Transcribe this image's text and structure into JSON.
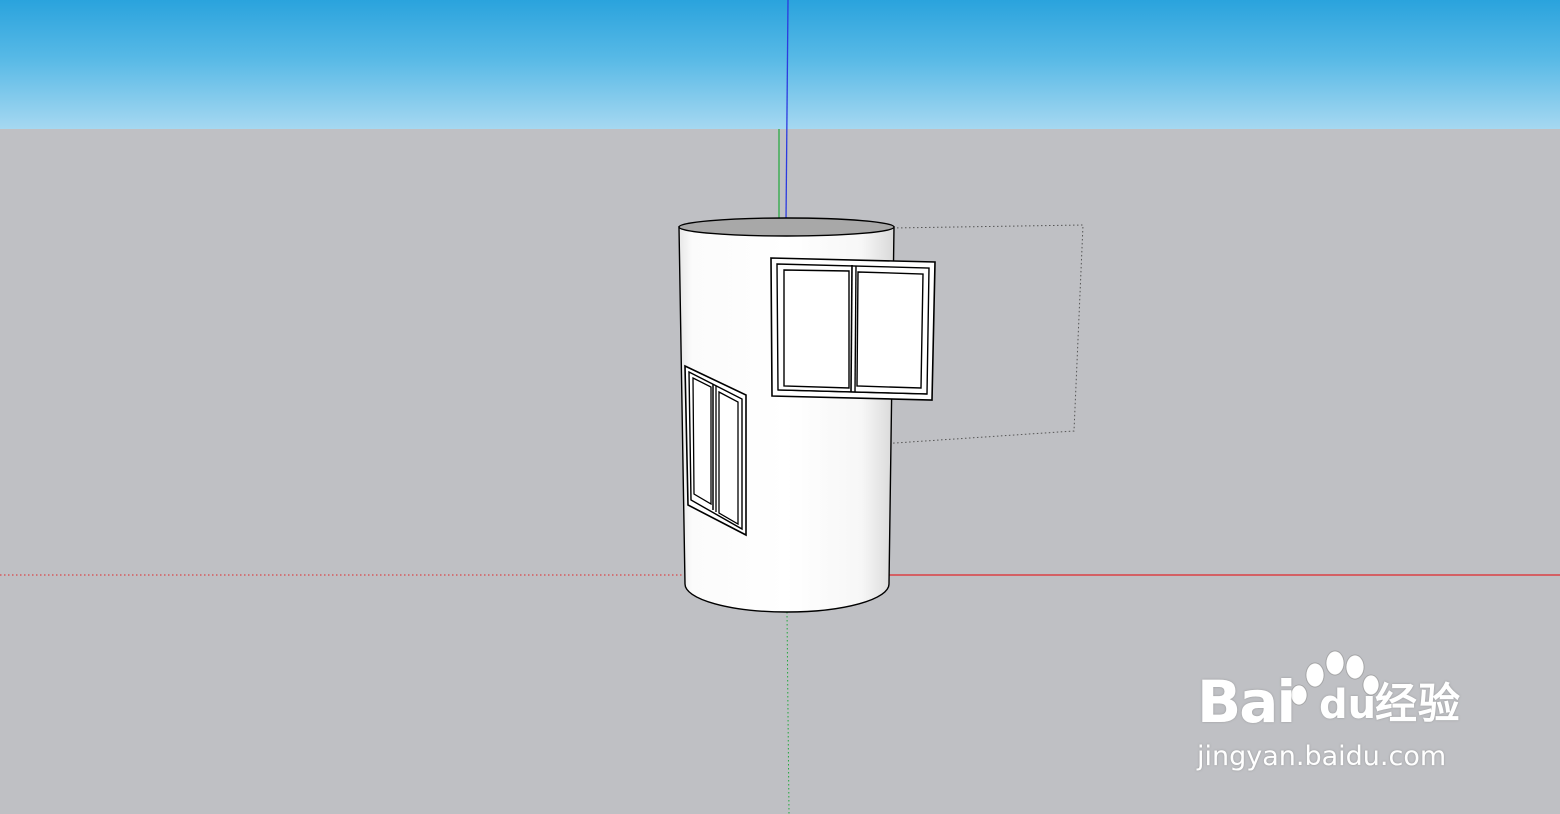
{
  "app": {
    "name": "SketchUp-style 3D modeling viewport"
  },
  "colors": {
    "sky_top": "#2aa3dd",
    "sky_bottom": "#a6d8f1",
    "ground": "#bfc0c4",
    "axis_red": "#e0262a",
    "axis_green": "#1fa83a",
    "axis_blue": "#2b3ae0",
    "model_face": "#ffffff",
    "edge": "#000000"
  },
  "scene": {
    "objects": [
      {
        "name": "cylinder-tower",
        "description_icon": "cylinder"
      },
      {
        "name": "window-front-open",
        "description_icon": "window"
      },
      {
        "name": "window-side",
        "description_icon": "window"
      },
      {
        "name": "selection-guide-box",
        "description_icon": "dotted-rectangle"
      }
    ],
    "axes": [
      "red-axis",
      "green-axis",
      "blue-axis"
    ]
  },
  "watermark": {
    "brand_part1": "Bai",
    "brand_part2": "du",
    "brand_cn": "经验",
    "url": "jingyan.baidu.com",
    "icon": "paw-icon"
  }
}
